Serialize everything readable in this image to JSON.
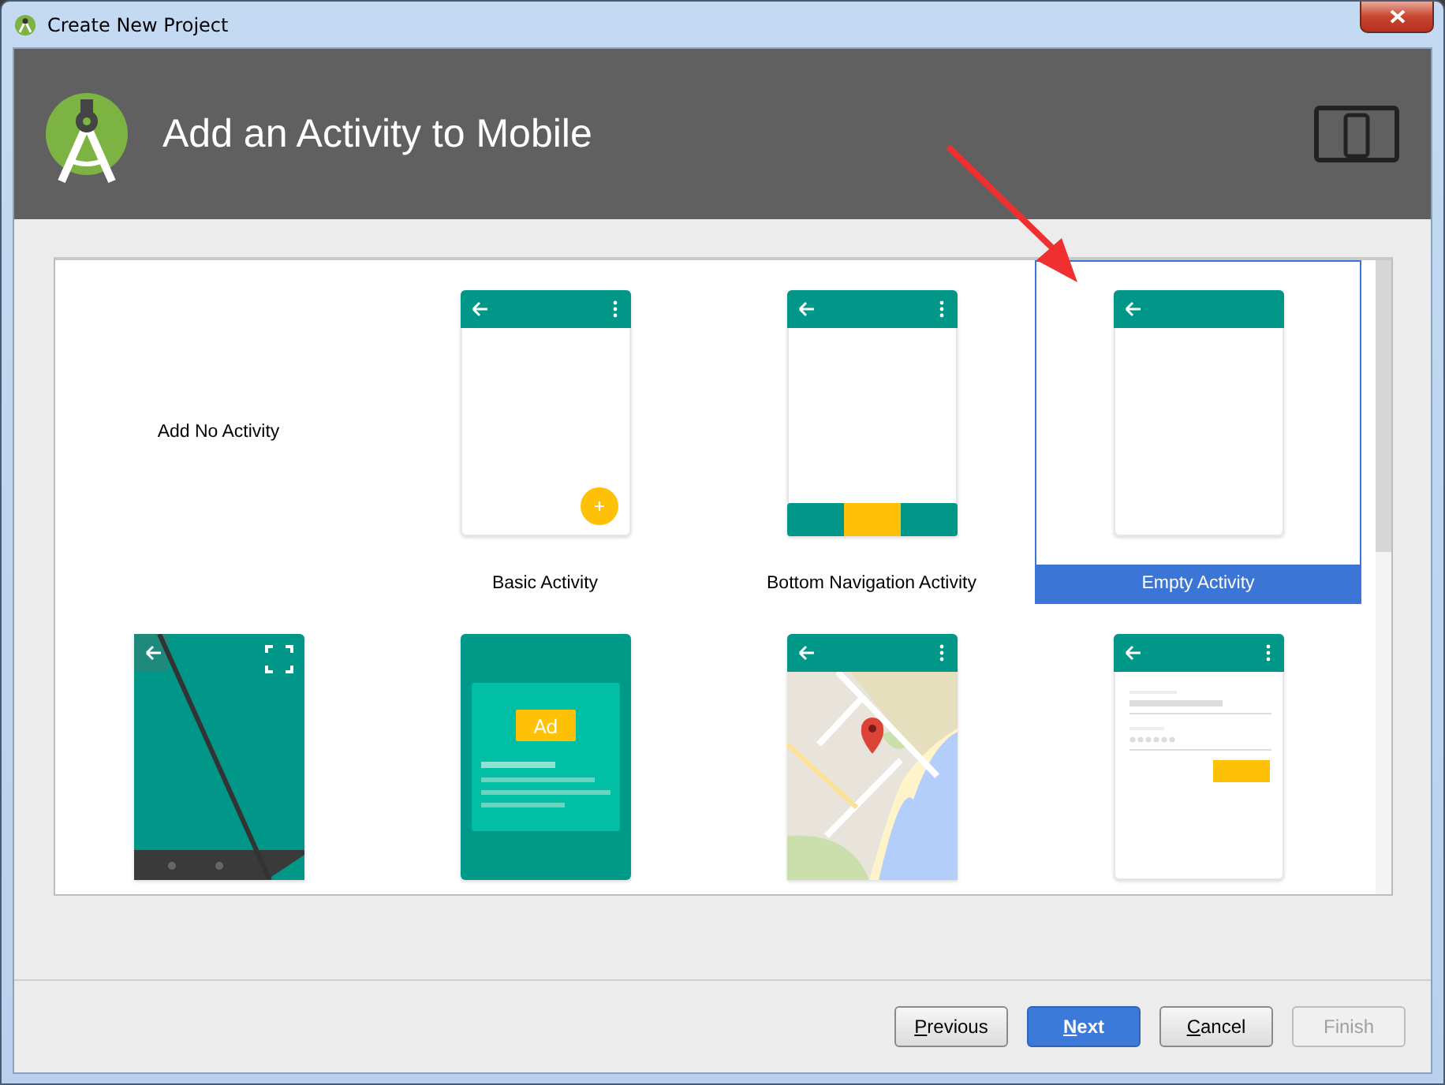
{
  "window": {
    "title": "Create New Project"
  },
  "header": {
    "title": "Add an Activity to Mobile"
  },
  "tiles": [
    {
      "kind": "none",
      "label": "Add No Activity",
      "selected": false
    },
    {
      "kind": "basic",
      "label": "Basic Activity",
      "selected": false
    },
    {
      "kind": "bottom_nav",
      "label": "Bottom Navigation Activity",
      "selected": false
    },
    {
      "kind": "empty",
      "label": "Empty Activity",
      "selected": true
    },
    {
      "kind": "fullscreen",
      "selected": false
    },
    {
      "kind": "ad",
      "badge": "Ad",
      "selected": false
    },
    {
      "kind": "maps",
      "selected": false
    },
    {
      "kind": "login",
      "selected": false
    }
  ],
  "annotation": {
    "kind": "arrow"
  },
  "buttons": [
    {
      "label": "Previous",
      "mnemonic": true,
      "default": false,
      "disabled": false
    },
    {
      "label": "Next",
      "mnemonic": true,
      "default": true,
      "disabled": false
    },
    {
      "label": "Cancel",
      "mnemonic": true,
      "default": false,
      "disabled": false
    },
    {
      "label": "Finish",
      "mnemonic": false,
      "default": false,
      "disabled": true
    }
  ]
}
